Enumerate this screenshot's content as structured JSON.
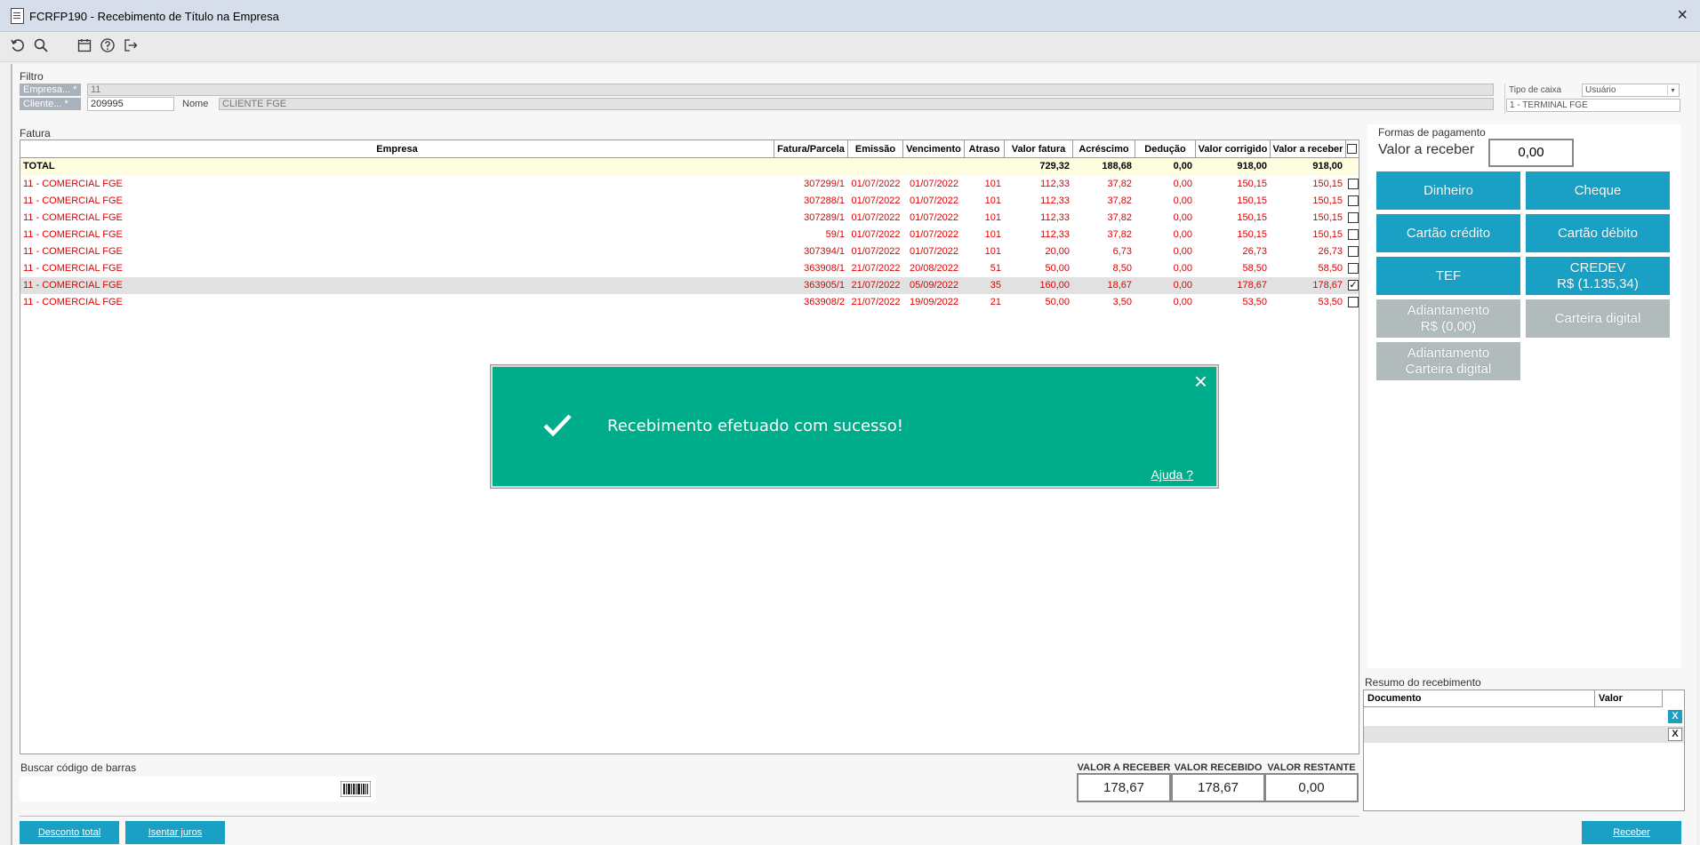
{
  "window": {
    "title": "FCRFP190 - Recebimento de Título na Empresa",
    "close_glyph": "×"
  },
  "filter": {
    "section_label": "Filtro",
    "empresa_label": "Empresa... *",
    "empresa_value": "11",
    "cliente_label": "Cliente... *",
    "cliente_value": "209995",
    "nome_label": "Nome",
    "nome_value": "CLIENTE FGE",
    "tipo_caixa_label": "Tipo de caixa",
    "tipo_caixa_value": "Usuário",
    "terminal_value": "1 - TERMINAL FGE"
  },
  "fatura": {
    "section_label": "Fatura",
    "columns": [
      "Empresa",
      "Fatura/Parcela",
      "Emissão",
      "Vencimento",
      "Atraso",
      "Valor fatura",
      "Acréscimo",
      "Dedução",
      "Valor corrigido",
      "Valor a receber"
    ],
    "total": {
      "label": "TOTAL",
      "valor_fatura": "729,32",
      "acrescimo": "188,68",
      "deducao": "0,00",
      "valor_corrigido": "918,00",
      "valor_receber": "918,00"
    },
    "rows": [
      {
        "empresa": "11 - COMERCIAL FGE",
        "parcela": "307299/1",
        "emissao": "01/07/2022",
        "vencimento": "01/07/2022",
        "atraso": "101",
        "valor_fatura": "112,33",
        "acrescimo": "37,82",
        "deducao": "0,00",
        "valor_corrigido": "150,15",
        "valor_receber": "150,15",
        "checked": false,
        "selected": false
      },
      {
        "empresa": "11 - COMERCIAL FGE",
        "parcela": "307288/1",
        "emissao": "01/07/2022",
        "vencimento": "01/07/2022",
        "atraso": "101",
        "valor_fatura": "112,33",
        "acrescimo": "37,82",
        "deducao": "0,00",
        "valor_corrigido": "150,15",
        "valor_receber": "150,15",
        "checked": false,
        "selected": false
      },
      {
        "empresa": "11 - COMERCIAL FGE",
        "parcela": "307289/1",
        "emissao": "01/07/2022",
        "vencimento": "01/07/2022",
        "atraso": "101",
        "valor_fatura": "112,33",
        "acrescimo": "37,82",
        "deducao": "0,00",
        "valor_corrigido": "150,15",
        "valor_receber": "150,15",
        "checked": false,
        "selected": false
      },
      {
        "empresa": "11 - COMERCIAL FGE",
        "parcela": "59/1",
        "emissao": "01/07/2022",
        "vencimento": "01/07/2022",
        "atraso": "101",
        "valor_fatura": "112,33",
        "acrescimo": "37,82",
        "deducao": "0,00",
        "valor_corrigido": "150,15",
        "valor_receber": "150,15",
        "checked": false,
        "selected": false
      },
      {
        "empresa": "11 - COMERCIAL FGE",
        "parcela": "307394/1",
        "emissao": "01/07/2022",
        "vencimento": "01/07/2022",
        "atraso": "101",
        "valor_fatura": "20,00",
        "acrescimo": "6,73",
        "deducao": "0,00",
        "valor_corrigido": "26,73",
        "valor_receber": "26,73",
        "checked": false,
        "selected": false
      },
      {
        "empresa": "11 - COMERCIAL FGE",
        "parcela": "363908/1",
        "emissao": "21/07/2022",
        "vencimento": "20/08/2022",
        "atraso": "51",
        "valor_fatura": "50,00",
        "acrescimo": "8,50",
        "deducao": "0,00",
        "valor_corrigido": "58,50",
        "valor_receber": "58,50",
        "checked": false,
        "selected": false
      },
      {
        "empresa": "11 - COMERCIAL FGE",
        "parcela": "363905/1",
        "emissao": "21/07/2022",
        "vencimento": "05/09/2022",
        "atraso": "35",
        "valor_fatura": "160,00",
        "acrescimo": "18,67",
        "deducao": "0,00",
        "valor_corrigido": "178,67",
        "valor_receber": "178,67",
        "checked": true,
        "selected": true
      },
      {
        "empresa": "11 - COMERCIAL FGE",
        "parcela": "363908/2",
        "emissao": "21/07/2022",
        "vencimento": "19/09/2022",
        "atraso": "21",
        "valor_fatura": "50,00",
        "acrescimo": "3,50",
        "deducao": "0,00",
        "valor_corrigido": "53,50",
        "valor_receber": "53,50",
        "checked": false,
        "selected": false
      }
    ]
  },
  "payment": {
    "section_label": "Formas de pagamento",
    "valor_receber_label": "Valor a receber",
    "valor_receber_value": "0,00",
    "buttons": {
      "dinheiro": "Dinheiro",
      "cheque": "Cheque",
      "cartao_credito": "Cartão crédito",
      "cartao_debito": "Cartão débito",
      "tef": "TEF",
      "credev_1": "CREDEV",
      "credev_2": "R$ (1.135,34)",
      "adiantamento_1": "Adiantamento",
      "adiantamento_2": "R$ (0,00)",
      "carteira_digital": "Carteira digital",
      "adiant_carteira_1": "Adiantamento",
      "adiant_carteira_2": "Carteira digital"
    }
  },
  "resumo": {
    "section_label": "Resumo do recebimento",
    "col_documento": "Documento",
    "col_valor": "Valor",
    "remove_glyph": "X"
  },
  "toast": {
    "message": "Recebimento efetuado com sucesso!",
    "help": "Ajuda ?",
    "close_glyph": "×"
  },
  "barcode": {
    "label": "Buscar código de barras"
  },
  "totals": {
    "valor_receber_label": "VALOR A RECEBER",
    "valor_receber": "178,67",
    "valor_recebido_label": "VALOR RECEBIDO",
    "valor_recebido": "178,67",
    "valor_restante_label": "VALOR RESTANTE",
    "valor_restante": "0,00"
  },
  "actions": {
    "desconto_total": "Desconto total",
    "isentar_juros": "Isentar juros",
    "receber": "Receber"
  },
  "colors": {
    "accent": "#1ba0c5",
    "toast": "#00ad8b",
    "disabled": "#b1bbbb",
    "overdue_text": "#e00000"
  }
}
